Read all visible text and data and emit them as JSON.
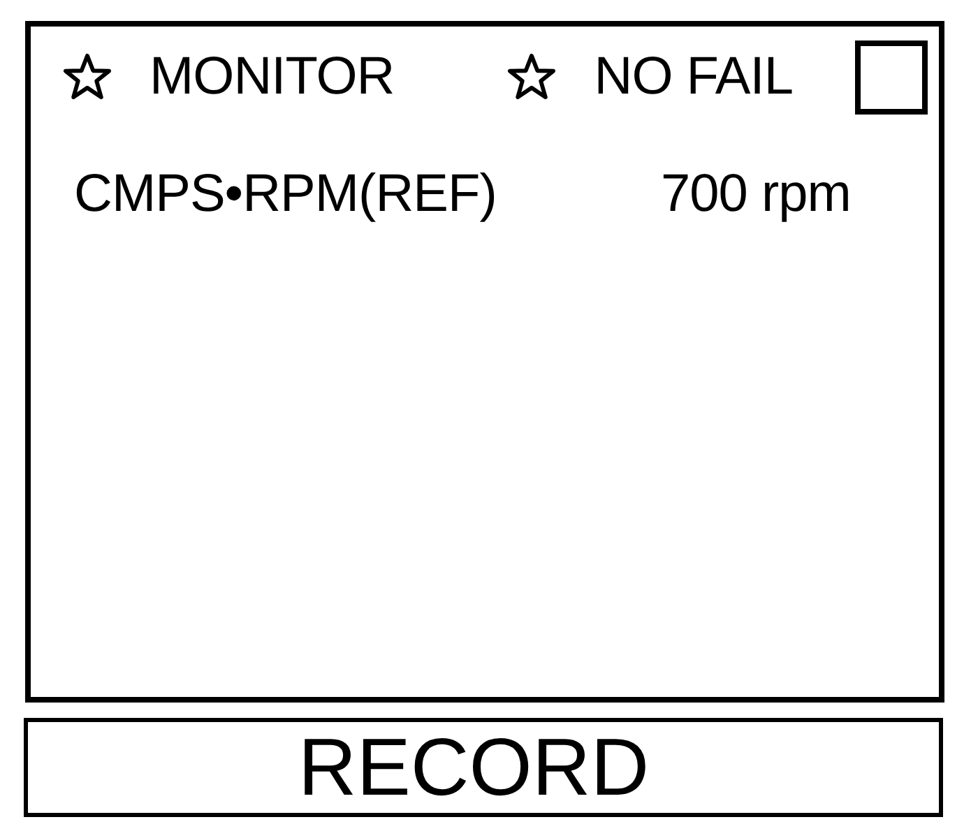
{
  "panel": {
    "flags": [
      {
        "label": "MONITOR"
      },
      {
        "label": "NO FAIL"
      }
    ],
    "checkbox": {
      "checked": false
    },
    "readings": [
      {
        "name": "CMPS•RPM(REF)",
        "value": "700 rpm"
      }
    ]
  },
  "button": {
    "label": "RECORD"
  }
}
